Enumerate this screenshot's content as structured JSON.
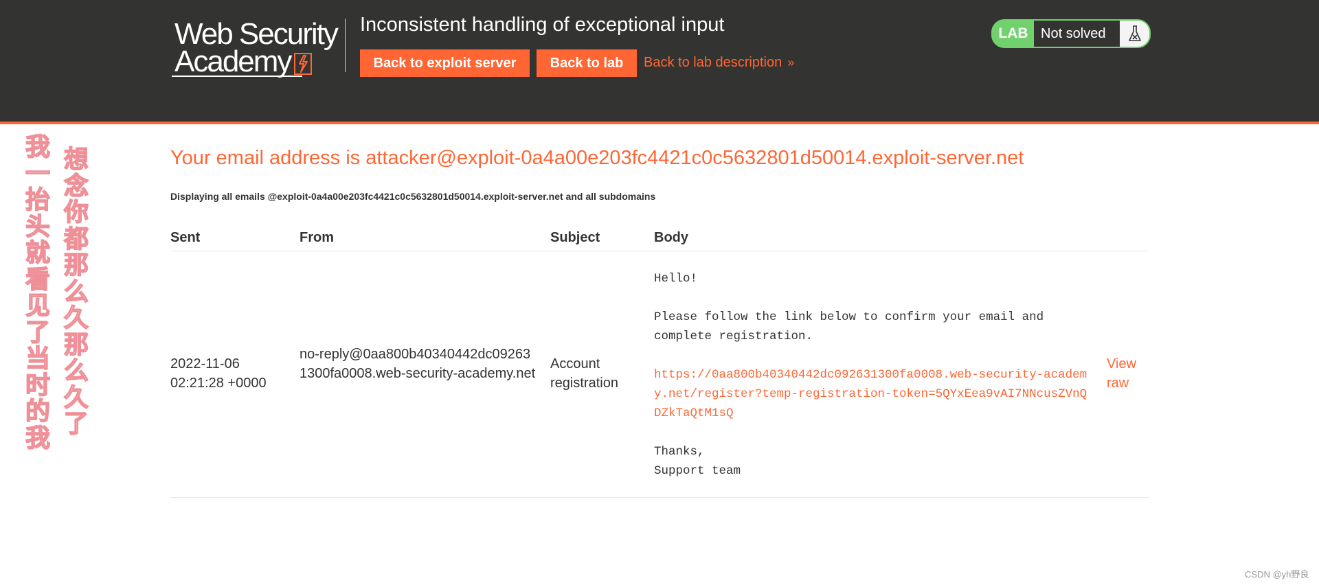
{
  "header": {
    "logo_line1": "Web Security",
    "logo_line2": "Academy",
    "lab_title": "Inconsistent handling of exceptional input",
    "back_to_exploit_label": "Back to exploit server",
    "back_to_lab_label": "Back to lab",
    "back_to_description_label": "Back to lab description",
    "status_badge": "LAB",
    "status_text": "Not solved"
  },
  "decorations": {
    "vertical_text_1": "我一抬头就看见了当时的我",
    "vertical_text_2": "想念你都那么久那么久了"
  },
  "main": {
    "email_heading": "Your email address is attacker@exploit-0a4a00e203fc4421c0c5632801d50014.exploit-server.net",
    "display_note": "Displaying all emails @exploit-0a4a00e203fc4421c0c5632801d50014.exploit-server.net and all subdomains",
    "columns": [
      "Sent",
      "From",
      "Subject",
      "Body"
    ],
    "emails": [
      {
        "sent": "2022-11-06 02:21:28 +0000",
        "from": "no-reply@0aa800b40340442dc092631300fa0008.web-security-academy.net",
        "subject": "Account registration",
        "body_greeting": "Hello!",
        "body_text": "Please follow the link below to confirm your email and complete registration.",
        "body_link": "https://0aa800b40340442dc092631300fa0008.web-security-academy.net/register?temp-registration-token=5QYxEea9vAI7NNcusZVnQDZkTaQtM1sQ",
        "body_signoff": "Thanks,",
        "body_signature": "Support team",
        "view_raw_label": "View raw"
      }
    ]
  },
  "footer": {
    "watermark": "CSDN @yh野良"
  },
  "colors": {
    "accent": "#ff6633",
    "header_bg": "#333332",
    "lab_green": "#70d16d",
    "decor_pink": "#ef8f97"
  }
}
